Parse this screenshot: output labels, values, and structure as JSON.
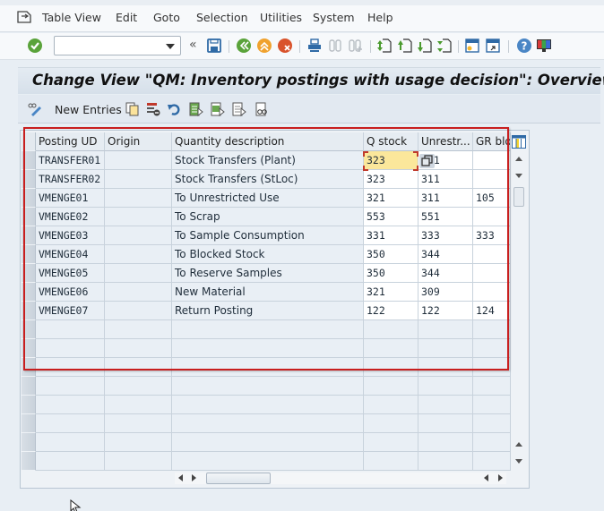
{
  "menubar": {
    "items": [
      "Table View",
      "Edit",
      "Goto",
      "Selection",
      "Utilities",
      "System",
      "Help"
    ],
    "icon": "menu-icon"
  },
  "toolbar": {
    "command_field_value": "",
    "icons": [
      "enter-icon",
      "command-field-dropdown",
      "collapse-icon",
      "save-icon",
      "back-icon",
      "exit-icon",
      "cancel-icon",
      "print-icon",
      "find-icon",
      "find-next-icon",
      "first-page-icon",
      "previous-page-icon",
      "next-page-icon",
      "last-page-icon",
      "create-session-icon",
      "generate-shortcut-icon",
      "help-icon",
      "customize-layout-icon"
    ]
  },
  "header": {
    "title": "Change View \"QM: Inventory postings with usage decision\": Overview"
  },
  "app_toolbar": {
    "new_entries_label": "New Entries",
    "icons": [
      "display-change-icon",
      "copy-as-icon",
      "delete-icon",
      "undo-change-icon",
      "select-all-icon",
      "select-block-icon",
      "deselect-all-icon",
      "print-view-icon"
    ]
  },
  "table": {
    "columns": [
      "Posting UD",
      "Origin",
      "Quantity description",
      "Q stock",
      "Unrestr...",
      "GR bloc"
    ],
    "rows": [
      {
        "posting_ud": "TRANSFER01",
        "origin": "",
        "description": "Stock Transfers (Plant)",
        "q_stock": "323",
        "unrestr": "311",
        "gr_bloc": ""
      },
      {
        "posting_ud": "TRANSFER02",
        "origin": "",
        "description": "Stock Transfers (StLoc)",
        "q_stock": "323",
        "unrestr": "311",
        "gr_bloc": ""
      },
      {
        "posting_ud": "VMENGE01",
        "origin": "",
        "description": "To Unrestricted Use",
        "q_stock": "321",
        "unrestr": "311",
        "gr_bloc": "105"
      },
      {
        "posting_ud": "VMENGE02",
        "origin": "",
        "description": "To Scrap",
        "q_stock": "553",
        "unrestr": "551",
        "gr_bloc": ""
      },
      {
        "posting_ud": "VMENGE03",
        "origin": "",
        "description": "To Sample Consumption",
        "q_stock": "331",
        "unrestr": "333",
        "gr_bloc": "333"
      },
      {
        "posting_ud": "VMENGE04",
        "origin": "",
        "description": "To Blocked Stock",
        "q_stock": "350",
        "unrestr": "344",
        "gr_bloc": ""
      },
      {
        "posting_ud": "VMENGE05",
        "origin": "",
        "description": "To Reserve Samples",
        "q_stock": "350",
        "unrestr": "344",
        "gr_bloc": ""
      },
      {
        "posting_ud": "VMENGE06",
        "origin": "",
        "description": "New Material",
        "q_stock": "321",
        "unrestr": "309",
        "gr_bloc": ""
      },
      {
        "posting_ud": "VMENGE07",
        "origin": "",
        "description": "Return Posting",
        "q_stock": "122",
        "unrestr": "122",
        "gr_bloc": "124"
      }
    ],
    "empty_rows": 8,
    "focused_cell": {
      "row": 0,
      "column": "Q stock"
    },
    "highlight_color": "#c81e1e",
    "focus_color": "#fbe79b"
  }
}
